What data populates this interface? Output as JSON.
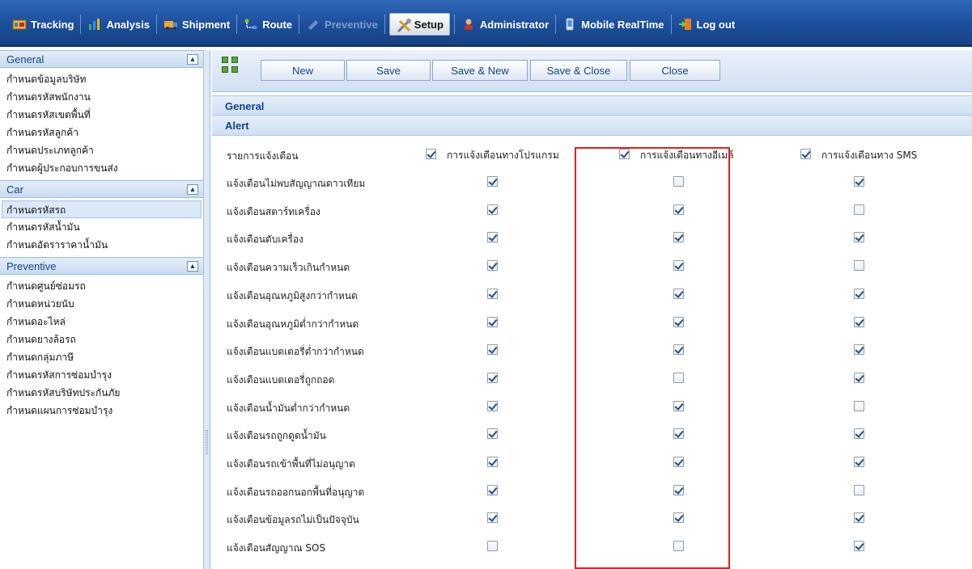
{
  "nav": {
    "items": [
      {
        "label": "Tracking",
        "icon": "tracking-icon",
        "state": "normal"
      },
      {
        "label": "Analysis",
        "icon": "analysis-icon",
        "state": "normal"
      },
      {
        "label": "Shipment",
        "icon": "shipment-icon",
        "state": "normal"
      },
      {
        "label": "Route",
        "icon": "route-icon",
        "state": "normal"
      },
      {
        "label": "Preventive",
        "icon": "preventive-icon",
        "state": "disabled"
      },
      {
        "label": "Setup",
        "icon": "setup-icon",
        "state": "active"
      },
      {
        "label": "Administrator",
        "icon": "administrator-icon",
        "state": "normal"
      },
      {
        "label": "Mobile RealTime",
        "icon": "mobile-icon",
        "state": "normal"
      },
      {
        "label": "Log out",
        "icon": "logout-icon",
        "state": "normal"
      }
    ]
  },
  "sidebar": {
    "sections": [
      {
        "title": "General",
        "items": [
          "กำหนดข้อมูลบริษัท",
          "กำหนดรหัสพนักงาน",
          "กำหนดรหัสเขตพื้นที่",
          "กำหนดรหัสลูกค้า",
          "กำหนดประเภทลูกค้า",
          "กำหนดผู้ประกอบการขนส่ง"
        ]
      },
      {
        "title": "Car",
        "items": [
          "กำหนดรหัสรถ",
          "กำหนดรหัสน้ำมัน",
          "กำหนดอัตราราคาน้ำมัน"
        ],
        "selected_index": 0
      },
      {
        "title": "Preventive",
        "items": [
          "กำหนดศูนย์ซ่อมรถ",
          "กำหนดหน่วยนับ",
          "กำหนดอะไหล่",
          "กำหนดยางล้อรถ",
          "กำหนดกลุ่มภาษี",
          "กำหนดรหัสการซ่อมบำรุง",
          "กำหนดรหัสบริษัทประกันภัย",
          "กำหนดแผนการซ่อมบำรุง"
        ]
      }
    ]
  },
  "toolbar": {
    "new_label": "New",
    "save_label": "Save",
    "save_new_label": "Save & New",
    "save_close_label": "Save & Close",
    "close_label": "Close"
  },
  "sections": {
    "general": "General",
    "alert": "Alert"
  },
  "alert_table": {
    "header_label": "รายการแจ้งเตือน",
    "columns": [
      {
        "label": "การแจ้งเตือนทางโปรแกรม",
        "checked": true
      },
      {
        "label": "การแจ้งเตือนทางอีเมล์",
        "checked": true
      },
      {
        "label": "การแจ้งเตือนทาง SMS",
        "checked": true
      }
    ],
    "rows": [
      {
        "label": "แจ้งเตือนไม่พบสัญญาณดาวเทียม",
        "program": true,
        "email": false,
        "sms": true
      },
      {
        "label": "แจ้งเตือนสตาร์ทเครื่อง",
        "program": true,
        "email": true,
        "sms": false
      },
      {
        "label": "แจ้งเตือนดับเครื่อง",
        "program": true,
        "email": true,
        "sms": true
      },
      {
        "label": "แจ้งเตือนความเร็วเกินกำหนด",
        "program": true,
        "email": true,
        "sms": false
      },
      {
        "label": "แจ้งเตือนอุณหภูมิสูงกว่ากำหนด",
        "program": true,
        "email": true,
        "sms": true
      },
      {
        "label": "แจ้งเตือนอุณหภูมิต่ำกว่ากำหนด",
        "program": true,
        "email": true,
        "sms": true
      },
      {
        "label": "แจ้งเตือนแบตเตอรี่ต่ำกว่ากำหนด",
        "program": true,
        "email": true,
        "sms": true
      },
      {
        "label": "แจ้งเตือนแบตเตอรี่ถูกถอด",
        "program": true,
        "email": false,
        "sms": true
      },
      {
        "label": "แจ้งเตือนน้ำมันต่ำกว่ากำหนด",
        "program": true,
        "email": true,
        "sms": false
      },
      {
        "label": "แจ้งเตือนรถถูกดูดน้ำมัน",
        "program": true,
        "email": true,
        "sms": true
      },
      {
        "label": "แจ้งเตือนรถเข้าพื้นที่ไม่อนุญาต",
        "program": true,
        "email": true,
        "sms": true
      },
      {
        "label": "แจ้งเตือนรถออกนอกพื้นที่อนุญาต",
        "program": true,
        "email": true,
        "sms": false
      },
      {
        "label": "แจ้งเตือนข้อมูลรถไม่เป็นปัจจุบัน",
        "program": true,
        "email": true,
        "sms": true
      },
      {
        "label": "แจ้งเตือนสัญญาณ SOS",
        "program": false,
        "email": false,
        "sms": true
      }
    ]
  },
  "colors": {
    "nav_bg": "#1c4e9c",
    "header_text": "#15428b",
    "highlight_box": "#e02020"
  }
}
